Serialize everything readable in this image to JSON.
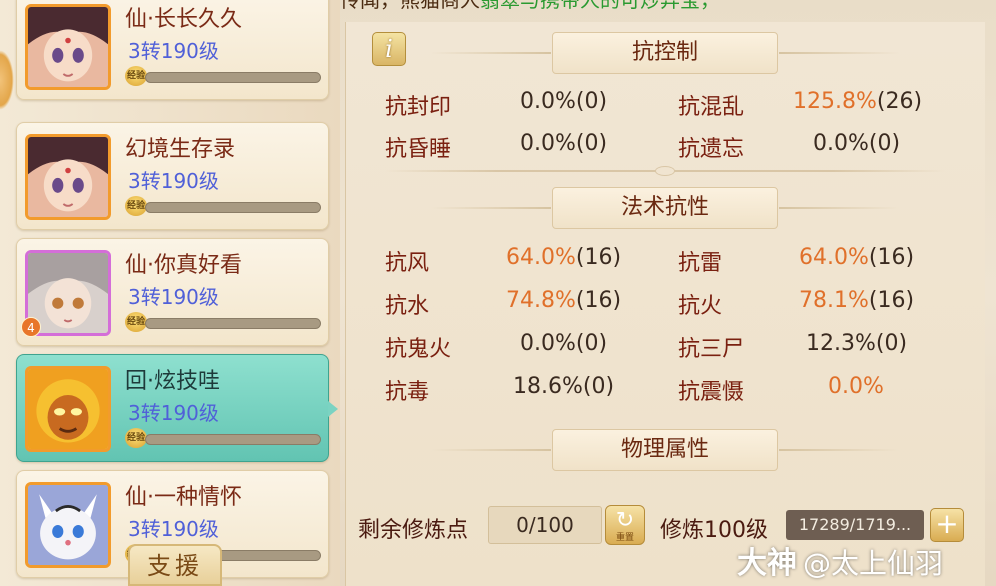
{
  "banner": {
    "prefix": "江湖传闻，熊猫商人",
    "highlight": "翡翠与携带人的可炒异宝，",
    "suffix": ""
  },
  "pets": [
    {
      "name": "仙·长长久久",
      "level": "3转190级",
      "exp_label": "经验"
    },
    {
      "name": "幻境生存录",
      "level": "3转190级",
      "exp_label": "经验"
    },
    {
      "name": "仙·你真好看",
      "level": "3转190级",
      "exp_label": "经验",
      "badge": "4"
    },
    {
      "name": "回·炫技哇",
      "level": "3转190级",
      "exp_label": "经验"
    },
    {
      "name": "仙·一种情怀",
      "level": "3转190级",
      "exp_label": "经验"
    }
  ],
  "assist_label": "支援",
  "info_icon": "i",
  "sections": {
    "control": {
      "title": "抗控制",
      "stats": [
        {
          "label": "抗封印",
          "value": "0.0%",
          "paren": "(0)"
        },
        {
          "label": "抗混乱",
          "value": "125.8%",
          "paren": "(26)"
        },
        {
          "label": "抗昏睡",
          "value": "0.0%",
          "paren": "(0)"
        },
        {
          "label": "抗遗忘",
          "value": "0.0%",
          "paren": "(0)"
        }
      ]
    },
    "magic": {
      "title": "法术抗性",
      "stats": [
        {
          "label": "抗风",
          "value": "64.0%",
          "paren": "(16)"
        },
        {
          "label": "抗雷",
          "value": "64.0%",
          "paren": "(16)"
        },
        {
          "label": "抗水",
          "value": "74.8%",
          "paren": "(16)"
        },
        {
          "label": "抗火",
          "value": "78.1%",
          "paren": "(16)"
        },
        {
          "label": "抗鬼火",
          "value": "0.0%",
          "paren": "(0)"
        },
        {
          "label": "抗三尸",
          "value": "12.3%",
          "paren": "(0)"
        },
        {
          "label": "抗毒",
          "value": "18.6%",
          "paren": "(0)"
        },
        {
          "label": "抗震慑",
          "value": "0.0%",
          "paren": ""
        }
      ]
    },
    "physical": {
      "title": "物理属性"
    }
  },
  "cultivation": {
    "remaining_label": "剩余修炼点",
    "remaining_value": "0/100",
    "reset_icon": "↻",
    "reset_label": "重置",
    "level_label": "修炼100级",
    "exp_value": "17289/1719...",
    "plus": "+"
  },
  "watermark": {
    "brand": "大神",
    "handle": "@太上仙羽"
  },
  "colors": {
    "highlight_orange": "#e0702a",
    "selected_card": "#62c4b2",
    "label_red": "#7a2010"
  }
}
